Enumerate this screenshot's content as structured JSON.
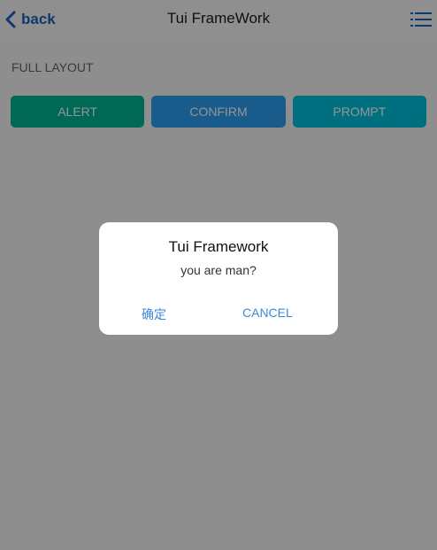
{
  "header": {
    "back_label": "back",
    "title": "Tui FrameWork",
    "back_icon": "chevron-left-icon",
    "menu_icon": "list-menu-icon"
  },
  "content": {
    "section_title": "FULL LAYOUT",
    "buttons": [
      {
        "label": "ALERT",
        "color": "#00b594"
      },
      {
        "label": "CONFIRM",
        "color": "#2b9df0"
      },
      {
        "label": "PROMPT",
        "color": "#00c2dc"
      }
    ]
  },
  "dialog": {
    "title": "Tui Framework",
    "message": "you are man?",
    "ok_label": "确定",
    "cancel_label": "CANCEL"
  },
  "colors": {
    "accent": "#1d63b8",
    "dialog_action": "#3a88d8"
  }
}
